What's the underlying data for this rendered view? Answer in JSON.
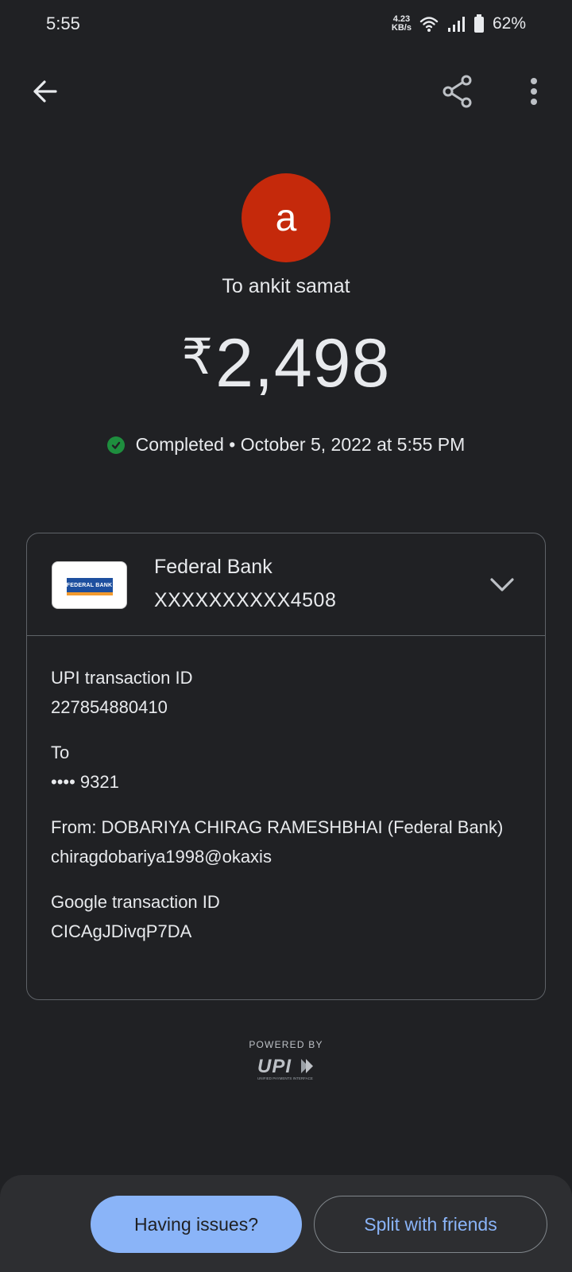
{
  "status_bar": {
    "time": "5:55",
    "net_speed_value": "4.23",
    "net_speed_unit": "KB/s",
    "battery": "62%"
  },
  "header": {
    "back_icon": "arrow-left-icon",
    "share_icon": "share-icon",
    "more_icon": "more-vert-icon"
  },
  "payee": {
    "avatar_letter": "a",
    "avatar_color": "#c5290b",
    "label": "To ankit samat"
  },
  "amount": {
    "currency": "₹",
    "value": "2,498"
  },
  "status": {
    "state": "Completed",
    "separator": "•",
    "datetime": "October 5, 2022 at 5:55 PM",
    "color": "#1e8e3e"
  },
  "bank": {
    "logo_text": "FEDERAL BANK",
    "name": "Federal Bank",
    "account": "XXXXXXXXXX4508"
  },
  "details": [
    {
      "label": "UPI transaction ID",
      "values": [
        "227854880410"
      ]
    },
    {
      "label": "To",
      "values": [
        "•••• 9321"
      ]
    },
    {
      "label": "From: DOBARIYA CHIRAG RAMESHBHAI (Federal Bank)",
      "values": [
        "chiragdobariya1998@okaxis"
      ]
    },
    {
      "label": "Google transaction ID",
      "values": [
        "CICAgJDivqP7DA"
      ]
    }
  ],
  "footer": {
    "powered_by": "POWERED BY",
    "upi_text": "UPI",
    "upi_subtext": "UNIFIED PAYMENTS INTERFACE"
  },
  "actions": {
    "issues_label": "Having issues?",
    "split_label": "Split with friends",
    "accent": "#8ab4f8"
  }
}
